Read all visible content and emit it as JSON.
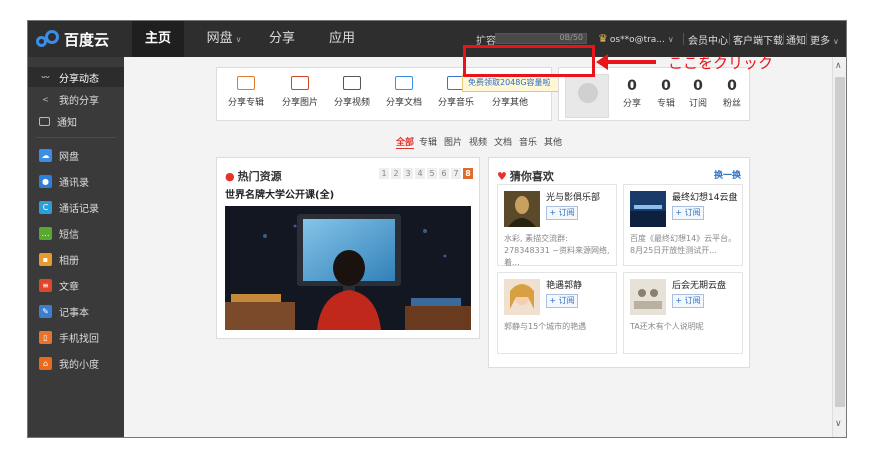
{
  "app": {
    "logo_text": "百度云"
  },
  "nav": {
    "tabs": [
      {
        "label": "主页",
        "active": true
      },
      {
        "label": "网盘",
        "has_dropdown": true
      },
      {
        "label": "分享"
      },
      {
        "label": "应用"
      }
    ],
    "quota_label": "扩容",
    "quota_text": "0B/50",
    "user_name": "os**o@tra...",
    "links": [
      "会员中心",
      "客户端下载",
      "通知",
      "更多"
    ]
  },
  "sidebar": {
    "items": [
      {
        "label": "分享动态",
        "icon": "activity-icon",
        "active": true
      },
      {
        "label": "我的分享",
        "icon": "share-icon"
      },
      {
        "label": "通知",
        "icon": "mail-icon"
      },
      {
        "label": "网盘",
        "icon": "cloud-icon"
      },
      {
        "label": "通讯录",
        "icon": "contacts-icon"
      },
      {
        "label": "通话记录",
        "icon": "call-log-icon"
      },
      {
        "label": "短信",
        "icon": "sms-icon"
      },
      {
        "label": "相册",
        "icon": "album-icon"
      },
      {
        "label": "文章",
        "icon": "article-icon"
      },
      {
        "label": "记事本",
        "icon": "notepad-icon"
      },
      {
        "label": "手机找回",
        "icon": "phone-find-icon"
      },
      {
        "label": "我的小度",
        "icon": "home-icon"
      }
    ]
  },
  "share_types": [
    "分享专辑",
    "分享图片",
    "分享视频",
    "分享文档",
    "分享音乐",
    "分享其他"
  ],
  "tooltip": {
    "text": "免费领取2048G容量啦",
    "close": "×"
  },
  "profile": {
    "stats": [
      {
        "value": "0",
        "label": "分享"
      },
      {
        "value": "0",
        "label": "专辑"
      },
      {
        "value": "0",
        "label": "订阅"
      },
      {
        "value": "0",
        "label": "粉丝"
      }
    ]
  },
  "filters": [
    "全部",
    "专辑",
    "图片",
    "视频",
    "文档",
    "音乐",
    "其他"
  ],
  "hot": {
    "title": "热门资源",
    "pages": [
      "1",
      "2",
      "3",
      "4",
      "5",
      "6",
      "7",
      "8"
    ],
    "active_page": "8",
    "subtitle": "世界名牌大学公开课(全)"
  },
  "recommend": {
    "title": "猜你喜欢",
    "more": "换一换",
    "subscribe_label": "+ 订阅",
    "cards": [
      {
        "name": "光与影俱乐部",
        "desc": "水彩, 素描交流群: 278348331 ~资料来源网络, 着..."
      },
      {
        "name": "最终幻想14云盘",
        "desc": "百度《最终幻想14》云平台。8月25日开放性测试开..."
      },
      {
        "name": "艳遇郭静",
        "desc": "郭静与15个城市的艳遇"
      },
      {
        "name": "后会无期云盘",
        "desc": "TA还木有个人说明呢"
      }
    ]
  },
  "annotation": {
    "callout": "ここをクリック"
  },
  "colors": {
    "accent": "#e5332a",
    "link": "#2a6fc4",
    "annotation": "#e8141a",
    "nav_bg": "#2e2e2e",
    "sidebar_bg": "#3a3a3a"
  }
}
